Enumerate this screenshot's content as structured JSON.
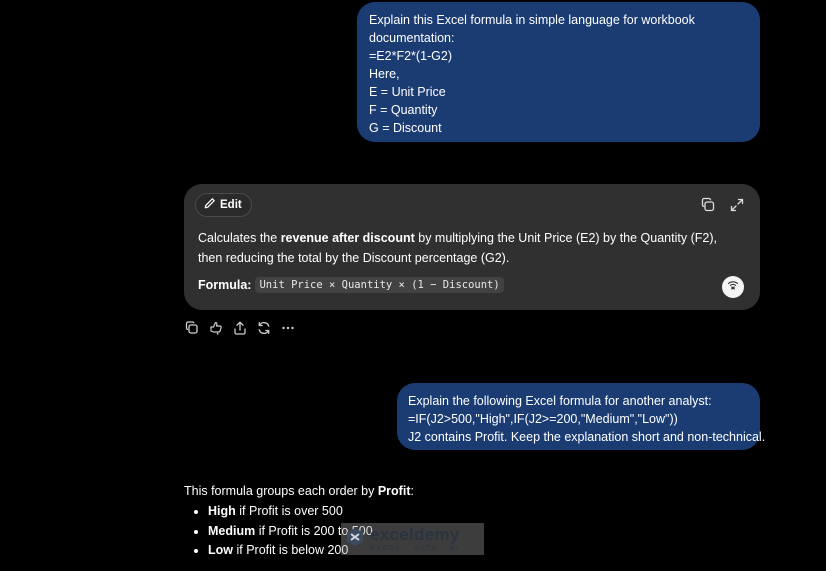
{
  "messages": {
    "first_prompt": {
      "lines": [
        "Explain this Excel formula in simple language for workbook documentation:",
        "=E2*F2*(1-G2)",
        "Here,",
        "E = Unit Price",
        "F = Quantity",
        "G = Discount"
      ]
    },
    "second_prompt": {
      "lines": [
        "Explain the following Excel formula for another analyst:",
        "=IF(J2>500,\"High\",IF(J2>=200,\"Medium\",\"Low\"))",
        "J2 contains Profit. Keep the explanation short and non-technical."
      ]
    }
  },
  "canvas_card": {
    "edit_label": "Edit",
    "body_part1": "Calculates the ",
    "body_bold": "revenue after discount",
    "body_part2": " by multiplying the Unit Price (E2) by the Quantity (F2), then reducing the total by the Discount percentage (G2).",
    "formula_label": "Formula:",
    "formula_code": "Unit Price × Quantity × (1 − Discount)",
    "icons": [
      "pencil-icon",
      "copy-icon",
      "expand-icon",
      "voice-icon"
    ]
  },
  "action_icons": [
    "copy-icon",
    "feedback-icon",
    "share-icon",
    "regenerate-icon",
    "more-icon"
  ],
  "answer": {
    "intro_pre": "This formula groups each order by ",
    "intro_bold": "Profit",
    "intro_post": ":",
    "items": [
      {
        "bold": "High",
        "text": " if Profit is over 500"
      },
      {
        "bold": "Medium",
        "text": " if Profit is 200 to 500"
      },
      {
        "bold": "Low",
        "text": " if Profit is below 200"
      }
    ]
  },
  "watermark": {
    "name": "exceldemy",
    "tagline": "EXCEL · DATA · BI"
  },
  "colors": {
    "background": "#000000",
    "user_bubble": "#1b3c73",
    "card": "#303030"
  }
}
